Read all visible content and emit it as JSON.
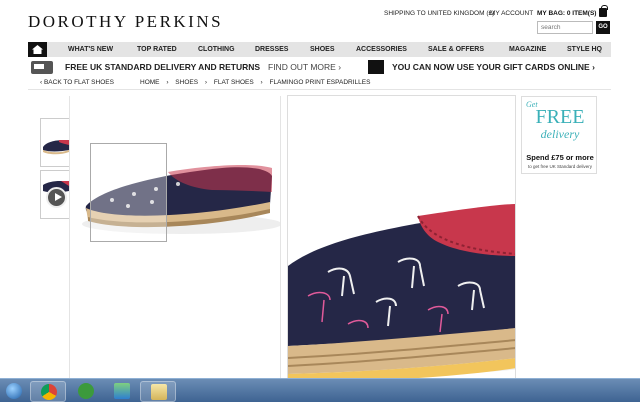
{
  "header": {
    "logo": "DOROTHY PERKINS",
    "shipping": "SHIPPING TO UNITED KINGDOM (£)",
    "account": "MY ACCOUNT",
    "bag": "MY BAG: 0 ITEM(S)",
    "search_placeholder": "search",
    "go_label": "GO"
  },
  "nav": {
    "items": [
      "WHAT'S NEW",
      "TOP RATED",
      "CLOTHING",
      "DRESSES",
      "SHOES",
      "ACCESSORIES",
      "SALE & OFFERS",
      "MAGAZINE",
      "STYLE HQ"
    ]
  },
  "promo": {
    "delivery_text": "FREE UK STANDARD DELIVERY AND RETURNS",
    "delivery_link": "FIND OUT MORE ›",
    "gift_text": "YOU CAN NOW USE YOUR GIFT CARDS ONLINE ›"
  },
  "breadcrumb": {
    "back": "‹ BACK TO FLAT SHOES",
    "items": [
      "HOME",
      "›",
      "SHOES",
      "›",
      "FLAT SHOES",
      "›",
      "FLAMINGO PRINT ESPADRILLES"
    ]
  },
  "delivery_banner": {
    "get": "Get",
    "free": "FREE",
    "delivery": "delivery",
    "spend": "Spend £75 or more",
    "sub": "to get free UK Standard delivery"
  },
  "taskbar": {
    "icons": [
      "start-orb-icon",
      "chrome-icon",
      "utorrent-icon",
      "network-icon",
      "folder-icon"
    ]
  },
  "colors": {
    "accent": "#3ab0b8",
    "nav_bg": "#e4e4e4",
    "shoe_navy": "#252747",
    "shoe_red": "#c8374c",
    "taskbar": "#3e6392"
  }
}
